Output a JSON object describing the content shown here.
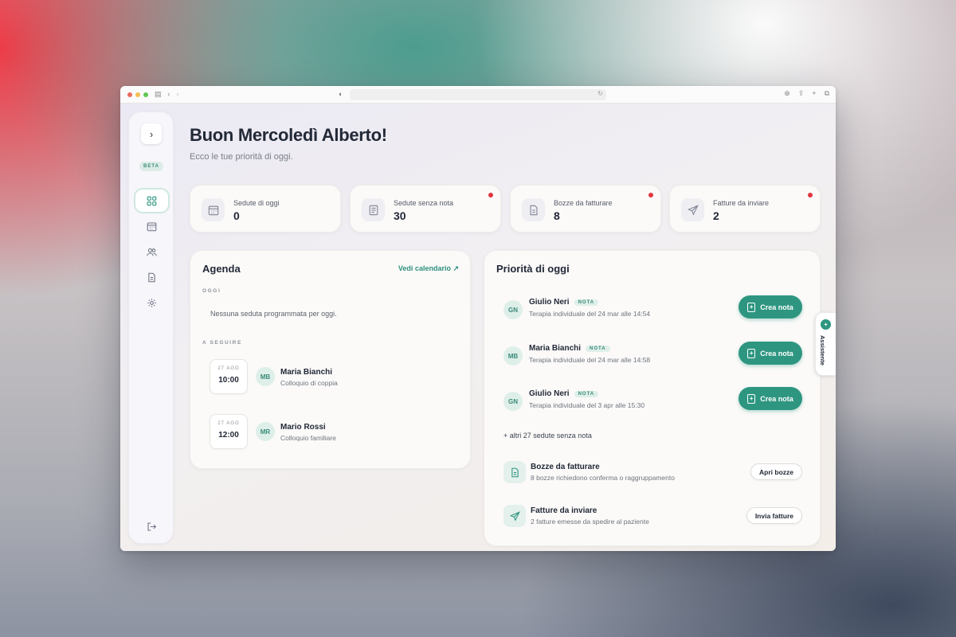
{
  "browser": {
    "traffic_lights": [
      "#ec6a5e",
      "#f4bf4f",
      "#61c554"
    ],
    "url": ""
  },
  "sidebar": {
    "toggle_icon": "chevron-right-icon",
    "beta_label": "BETA",
    "items": [
      {
        "name": "dashboard",
        "icon": "grid-icon",
        "active": true
      },
      {
        "name": "calendar",
        "icon": "calendar-icon",
        "active": false
      },
      {
        "name": "patients",
        "icon": "users-icon",
        "active": false
      },
      {
        "name": "documents",
        "icon": "document-icon",
        "active": false
      },
      {
        "name": "settings",
        "icon": "gear-icon",
        "active": false
      }
    ],
    "logout_icon": "logout-icon"
  },
  "header": {
    "title": "Buon Mercoledì Alberto!",
    "subtitle": "Ecco le tue priorità di oggi."
  },
  "kpis": [
    {
      "label": "Sedute di oggi",
      "value": "0",
      "icon": "calendar-icon",
      "alert": false
    },
    {
      "label": "Sedute senza nota",
      "value": "30",
      "icon": "notes-icon",
      "alert": true
    },
    {
      "label": "Bozze da fatturare",
      "value": "8",
      "icon": "document-icon",
      "alert": true
    },
    {
      "label": "Fatture da inviare",
      "value": "2",
      "icon": "send-icon",
      "alert": true
    }
  ],
  "agenda": {
    "title": "Agenda",
    "link": "Vedi calendario ↗",
    "today_label": "OGGI",
    "empty_text": "Nessuna seduta programmata per oggi.",
    "upcoming_label": "A SEGUIRE",
    "appointments": [
      {
        "date": "27 AGO",
        "time": "10:00",
        "initials": "MB",
        "name": "Maria Bianchi",
        "type": "Colloquio di coppia"
      },
      {
        "date": "27 AGO",
        "time": "12:00",
        "initials": "MR",
        "name": "Mario Rossi",
        "type": "Colloquio familiare"
      }
    ]
  },
  "priority": {
    "title": "Priorità di oggi",
    "badge": "NOTA",
    "action_label": "Crea nota",
    "rows": [
      {
        "initials": "GN",
        "name": "Giulio Neri",
        "detail": "Terapia individuale del 24 mar alle 14:54"
      },
      {
        "initials": "MB",
        "name": "Maria Bianchi",
        "detail": "Terapia individuale del 24 mar alle 14:58"
      },
      {
        "initials": "GN",
        "name": "Giulio Neri",
        "detail": "Terapia individuale del 3 apr alle 15:30"
      }
    ],
    "more": "+ altri 27 sedute senza nota",
    "tasks": [
      {
        "icon": "document-icon",
        "title": "Bozze da fatturare",
        "detail": "8 bozze richiedono conferma o raggruppamento",
        "button": "Apri bozze"
      },
      {
        "icon": "send-icon",
        "title": "Fatture da inviare",
        "detail": "2 fatture emesse da spedire al paziente",
        "button": "Invia fatture"
      }
    ]
  },
  "assistant": {
    "label": "Assistente",
    "icon": "sparkle-icon"
  },
  "colors": {
    "accent": "#2e9680",
    "alert": "#e0363f",
    "text": "#222937"
  }
}
